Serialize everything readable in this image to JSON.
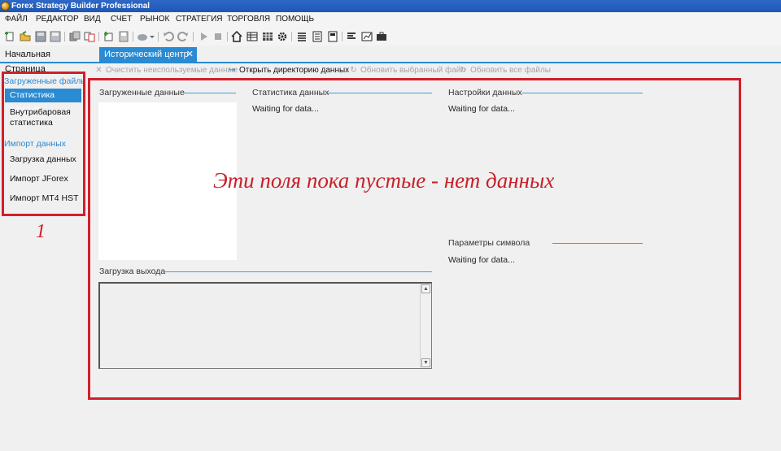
{
  "window": {
    "title": "Forex Strategy Builder Professional"
  },
  "menu": [
    "ФАЙЛ",
    "РЕДАКТОР",
    "ВИД",
    "СЧЕТ",
    "РЫНОК",
    "СТРАТЕГИЯ",
    "ТОРГОВЛЯ",
    "ПОМОЩЬ"
  ],
  "tabs": [
    {
      "label": "Начальная Страница",
      "active": false
    },
    {
      "label": "Исторический центр",
      "active": true
    }
  ],
  "tab_close_glyph": "✕",
  "sub_toolbar": {
    "clear_unused": "Очистить неиспользуемые данные",
    "open_data_dir": "Открыть директорию данных",
    "update_selected": "Обновить выбранный файл",
    "update_all": "Обновить все файлы"
  },
  "sidebar": {
    "loaded_files_header": "Загруженные файлы",
    "data_stats": "Статистика данных",
    "intrabar_stats": "Внутрибаровая статистика",
    "import_header": "Импорт данных",
    "data_loading": "Загрузка данных",
    "import_jforex": "Импорт JForex",
    "import_mt4": "Импорт MT4 HST"
  },
  "panels": {
    "loaded_data": {
      "title": "Загруженные данные"
    },
    "data_stats": {
      "title": "Статистика данных",
      "status": "Waiting for data..."
    },
    "data_settings": {
      "title": "Настройки данных",
      "status": "Waiting for data..."
    },
    "symbol_params": {
      "title": "Параметры символа",
      "status": "Waiting for data..."
    },
    "output_log": {
      "title": "Загрузка выхода"
    }
  },
  "annotation": {
    "text": "Эти поля пока пустые - нет данных",
    "number": "1",
    "color": "#d0202a"
  },
  "colors": {
    "accent": "#2a8ad2",
    "titlebar": "#1f56b4"
  }
}
